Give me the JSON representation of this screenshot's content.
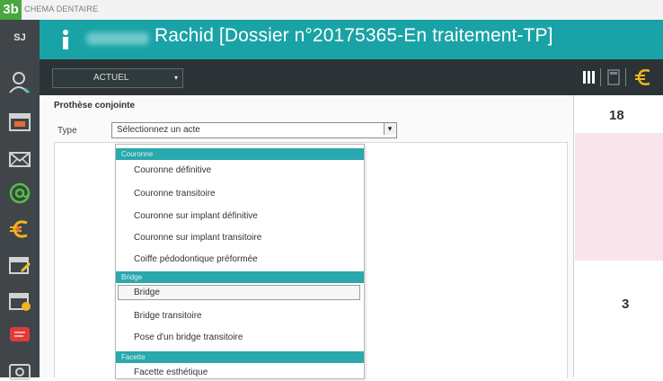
{
  "badge": "3b",
  "window_title": "CHEMA DENTAIRE",
  "user": {
    "initials": "SJ"
  },
  "header": {
    "patient_title": "Rachid [Dossier n°20175365-En traitement-TP]"
  },
  "toolbar": {
    "period_select": "ACTUEL"
  },
  "panel": {
    "title": "Prothèse conjointe",
    "type_label": "Type",
    "type_select_value": "Sélectionnez un acte"
  },
  "dropdown": {
    "groups": [
      {
        "label": "Couronne",
        "items": [
          "Couronne définitive",
          "Couronne transitoire",
          "Couronne sur implant définitive",
          "Couronne sur implant transitoire",
          "Coiffe pédodontique préformée"
        ]
      },
      {
        "label": "Bridge",
        "items": [
          "Bridge",
          "Bridge transitoire",
          "Pose d'un bridge transitoire"
        ]
      },
      {
        "label": "Facette",
        "items": [
          "Facette esthétique"
        ]
      }
    ],
    "highlighted_item": "Bridge"
  },
  "chart": {
    "upper_tooth": "18",
    "lower_tooth": "3"
  },
  "colors": {
    "teal": "#1aa3a6",
    "toolbar_dark": "#2c3336",
    "sidebar": "#3f4548",
    "badge_green": "#49a640",
    "group_header": "#29a8ad"
  },
  "icons": [
    "user-icon",
    "calendar-icon",
    "mail-icon",
    "at-icon",
    "euro-arrow-icon",
    "calendar-edit-icon",
    "calendar-clock-icon",
    "message-icon",
    "camera-icon",
    "columns-view-icon",
    "calculator-icon",
    "euro-icon"
  ]
}
